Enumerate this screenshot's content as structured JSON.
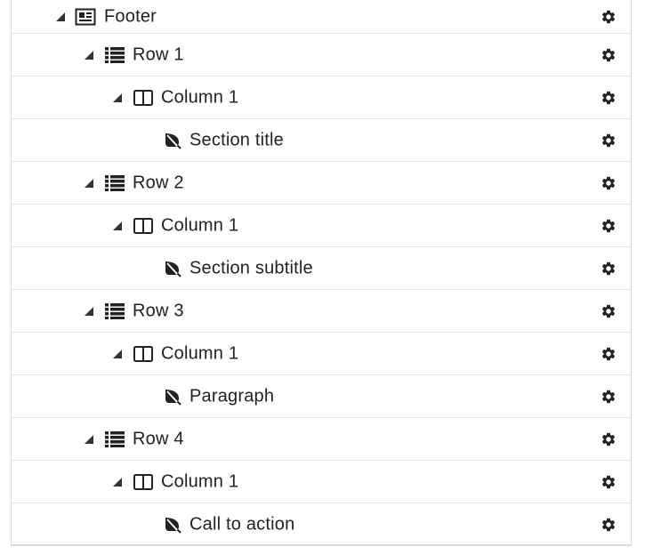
{
  "tree": {
    "items": [
      {
        "label": "Footer",
        "icon": "section-icon"
      },
      {
        "label": "Row 1",
        "icon": "list-icon"
      },
      {
        "label": "Column 1",
        "icon": "column-icon"
      },
      {
        "label": "Section title",
        "icon": "leaf-icon"
      },
      {
        "label": "Row 2",
        "icon": "list-icon"
      },
      {
        "label": "Column 1",
        "icon": "column-icon"
      },
      {
        "label": "Section subtitle",
        "icon": "leaf-icon"
      },
      {
        "label": "Row 3",
        "icon": "list-icon"
      },
      {
        "label": "Column 1",
        "icon": "column-icon"
      },
      {
        "label": "Paragraph",
        "icon": "leaf-icon"
      },
      {
        "label": "Row 4",
        "icon": "list-icon"
      },
      {
        "label": "Column 1",
        "icon": "column-icon"
      },
      {
        "label": "Call to action",
        "icon": "leaf-icon"
      }
    ]
  },
  "colors": {
    "text": "#222222",
    "icon": "#222222",
    "border": "#e3e3e3"
  }
}
